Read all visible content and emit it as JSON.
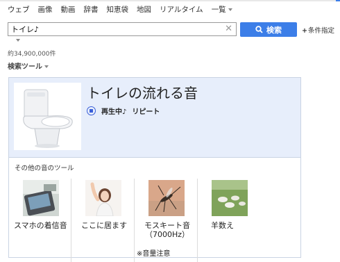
{
  "nav": {
    "tabs": [
      "ウェブ",
      "画像",
      "動画",
      "辞書",
      "知恵袋",
      "地図",
      "リアルタイム",
      "一覧"
    ]
  },
  "search": {
    "query": "トイレ♪",
    "button_label": "検索",
    "conditions_label": "条件指定"
  },
  "results": {
    "count": "約34,900,000件",
    "tools_label": "検索ツール"
  },
  "player": {
    "title": "トイレの流れる音",
    "status": "再生中♪",
    "repeat": "リピート"
  },
  "other_tools": {
    "heading": "その他の音のツール",
    "items": [
      {
        "label": "スマホの着信音"
      },
      {
        "label": "ここに居ます"
      },
      {
        "label": "モスキート音（7000Hz）",
        "note": "※音量注意"
      },
      {
        "label": "羊数え"
      }
    ]
  },
  "colors": {
    "accent": "#3c7ee8",
    "card_bg": "#e7eefb",
    "card_border": "#c9d3e3"
  }
}
